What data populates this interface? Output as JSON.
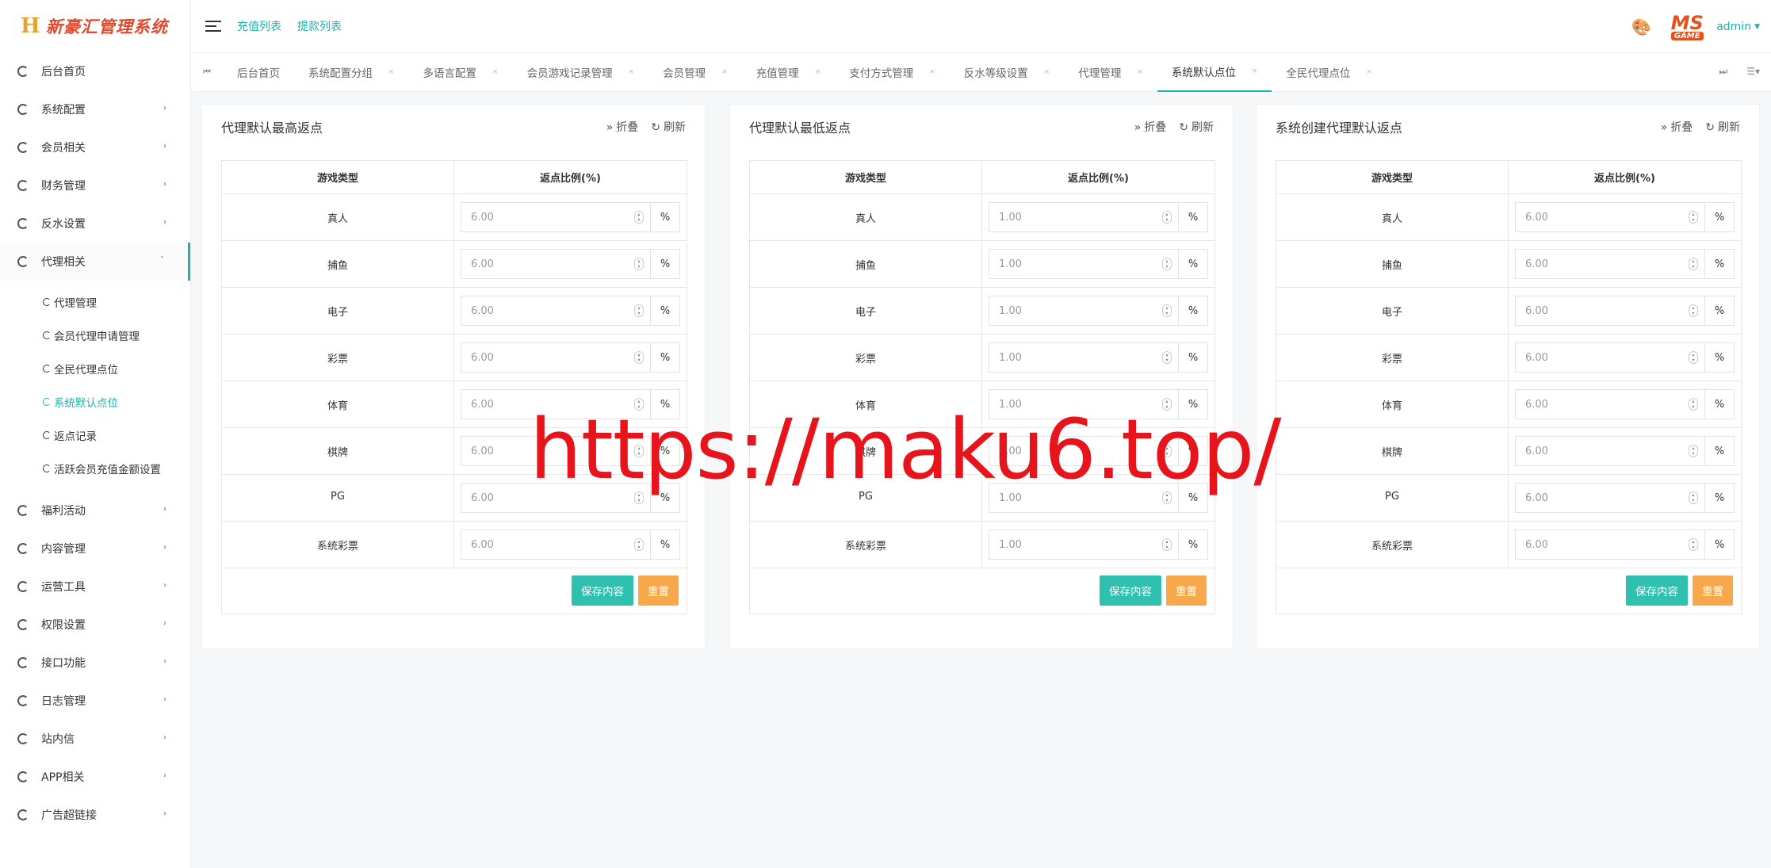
{
  "app": {
    "title": "新豪汇管理系统",
    "logo_mark": "H"
  },
  "sidebar": {
    "items": [
      {
        "label": "后台首页",
        "arrow": ""
      },
      {
        "label": "系统配置",
        "arrow": "›"
      },
      {
        "label": "会员相关",
        "arrow": "›"
      },
      {
        "label": "财务管理",
        "arrow": "›"
      },
      {
        "label": "反水设置",
        "arrow": "›"
      },
      {
        "label": "代理相关",
        "arrow": "ˇ"
      },
      {
        "label": "福利活动",
        "arrow": "›"
      },
      {
        "label": "内容管理",
        "arrow": "›"
      },
      {
        "label": "运营工具",
        "arrow": "›"
      },
      {
        "label": "权限设置",
        "arrow": "›"
      },
      {
        "label": "接口功能",
        "arrow": "›"
      },
      {
        "label": "日志管理",
        "arrow": "›"
      },
      {
        "label": "站内信",
        "arrow": "›"
      },
      {
        "label": "APP相关",
        "arrow": "›"
      },
      {
        "label": "广告超链接",
        "arrow": "›"
      }
    ],
    "sub_items": [
      "代理管理",
      "会员代理申请管理",
      "全民代理点位",
      "系统默认点位",
      "返点记录",
      "活跃会员充值金额设置"
    ]
  },
  "header": {
    "links": [
      "充值列表",
      "提款列表"
    ],
    "avatar_ms": "MS",
    "avatar_game": "GAME",
    "user": "admin"
  },
  "tabs": [
    "后台首页",
    "系统配置分组",
    "多语言配置",
    "会员游戏记录管理",
    "会员管理",
    "充值管理",
    "支付方式管理",
    "反水等级设置",
    "代理管理",
    "系统默认点位",
    "全民代理点位"
  ],
  "tab_close": "×",
  "card_tools": {
    "collapse": "折叠",
    "refresh": "刷新"
  },
  "table_headers": {
    "type": "游戏类型",
    "ratio": "返点比例(%)"
  },
  "unit": "%",
  "buttons": {
    "save": "保存内容",
    "reset": "重置"
  },
  "cards": [
    {
      "title": "代理默认最高返点",
      "rows": [
        {
          "type": "真人",
          "value": "6.00"
        },
        {
          "type": "捕鱼",
          "value": "6.00"
        },
        {
          "type": "电子",
          "value": "6.00"
        },
        {
          "type": "彩票",
          "value": "6.00"
        },
        {
          "type": "体育",
          "value": "6.00"
        },
        {
          "type": "棋牌",
          "value": "6.00"
        },
        {
          "type": "PG",
          "value": "6.00"
        },
        {
          "type": "系统彩票",
          "value": "6.00"
        }
      ]
    },
    {
      "title": "代理默认最低返点",
      "rows": [
        {
          "type": "真人",
          "value": "1.00"
        },
        {
          "type": "捕鱼",
          "value": "1.00"
        },
        {
          "type": "电子",
          "value": "1.00"
        },
        {
          "type": "彩票",
          "value": "1.00"
        },
        {
          "type": "体育",
          "value": "1.00"
        },
        {
          "type": "棋牌",
          "value": "1.00"
        },
        {
          "type": "PG",
          "value": "1.00"
        },
        {
          "type": "系统彩票",
          "value": "1.00"
        }
      ]
    },
    {
      "title": "系统创建代理默认返点",
      "rows": [
        {
          "type": "真人",
          "value": "6.00"
        },
        {
          "type": "捕鱼",
          "value": "6.00"
        },
        {
          "type": "电子",
          "value": "6.00"
        },
        {
          "type": "彩票",
          "value": "6.00"
        },
        {
          "type": "体育",
          "value": "6.00"
        },
        {
          "type": "棋牌",
          "value": "6.00"
        },
        {
          "type": "PG",
          "value": "6.00"
        },
        {
          "type": "系统彩票",
          "value": "6.00"
        }
      ]
    }
  ],
  "watermark": "https://maku6.top/",
  "colors": {
    "accent": "#20b2aa",
    "save": "#30c0b0",
    "reset": "#f7a84a",
    "watermark": "#e8141c"
  }
}
